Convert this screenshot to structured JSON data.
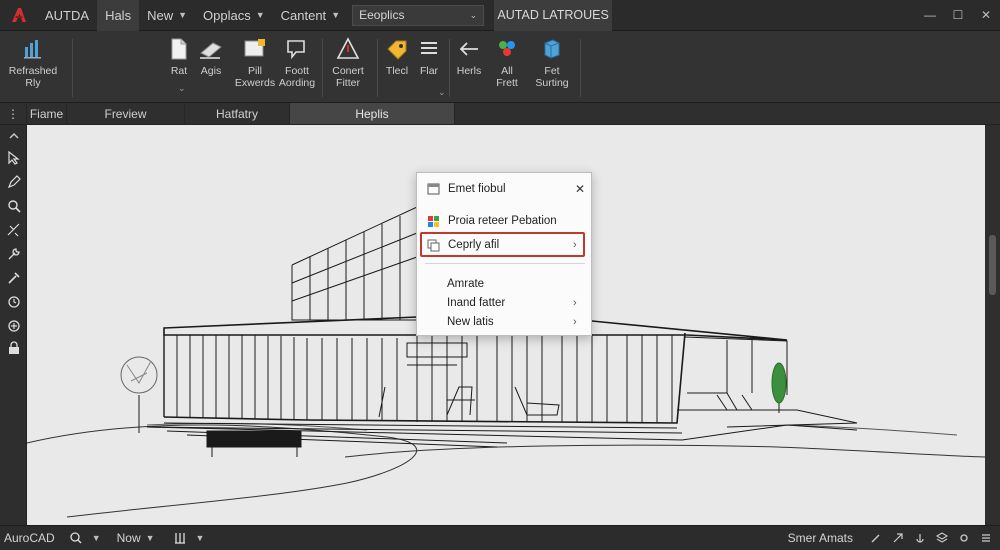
{
  "titlebar": {
    "app_name": "AUTDA",
    "menus": [
      {
        "label": "Hals"
      },
      {
        "label": "New"
      },
      {
        "label": "Opplacs"
      },
      {
        "label": "Cantent"
      }
    ],
    "search_value": "Eeoplics",
    "workspace_tab": "AUTAD LATROUES"
  },
  "ribbon": {
    "buttons": [
      {
        "label": "Refrashed Rly"
      },
      {
        "label": "Rat"
      },
      {
        "label": "Agis"
      },
      {
        "label": "Pill Exwerds"
      },
      {
        "label": "Foott Aording"
      },
      {
        "label": "Conert Fitter"
      },
      {
        "label": "Tlecl"
      },
      {
        "label": "Flar"
      },
      {
        "label": "Herls"
      },
      {
        "label": "All Frett"
      },
      {
        "label": "Fet Surting"
      }
    ]
  },
  "filetabs": [
    {
      "label": "Fiame"
    },
    {
      "label": "Freview"
    },
    {
      "label": "Hatfatry"
    },
    {
      "label": "Heplis"
    }
  ],
  "context_menu": {
    "items": [
      {
        "label": "Emet fiobul",
        "trailing": "✕"
      },
      {
        "label": "Proia reteer Pebation"
      },
      {
        "label": "Ceprly afil",
        "trailing": "›"
      },
      {
        "label": "Amrate"
      },
      {
        "label": "Inand fatter",
        "trailing": "›"
      },
      {
        "label": "New latis",
        "trailing": "›"
      }
    ]
  },
  "statusbar": {
    "app_label": "AuroCAD",
    "now_label": "Now",
    "right_label": "Smer Amats"
  },
  "colors": {
    "highlight": "#c0392b",
    "viewport": "#e9e9e9",
    "chrome": "#2b2b2b"
  }
}
